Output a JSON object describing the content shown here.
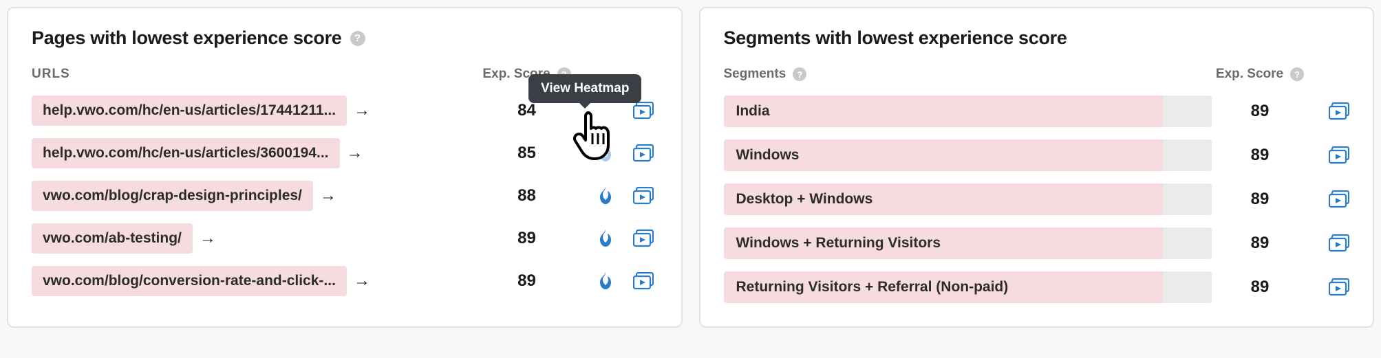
{
  "tooltip": "View Heatmap",
  "pages_card": {
    "title": "Pages with lowest experience score",
    "url_header": "URLS",
    "score_header": "Exp. Score",
    "rows": [
      {
        "url": "help.vwo.com/hc/en-us/articles/17441211...",
        "score": "84"
      },
      {
        "url": "help.vwo.com/hc/en-us/articles/3600194...",
        "score": "85"
      },
      {
        "url": "vwo.com/blog/crap-design-principles/",
        "score": "88"
      },
      {
        "url": "vwo.com/ab-testing/",
        "score": "89"
      },
      {
        "url": "vwo.com/blog/conversion-rate-and-click-...",
        "score": "89"
      }
    ]
  },
  "segments_card": {
    "title": "Segments with lowest experience score",
    "seg_header": "Segments",
    "score_header": "Exp. Score",
    "rows": [
      {
        "label": "India",
        "score": "89",
        "fill": 90
      },
      {
        "label": "Windows",
        "score": "89",
        "fill": 90
      },
      {
        "label": "Desktop + Windows",
        "score": "89",
        "fill": 90
      },
      {
        "label": "Windows + Returning Visitors",
        "score": "89",
        "fill": 90
      },
      {
        "label": "Returning Visitors + Referral (Non-paid)",
        "score": "89",
        "fill": 90
      }
    ]
  }
}
